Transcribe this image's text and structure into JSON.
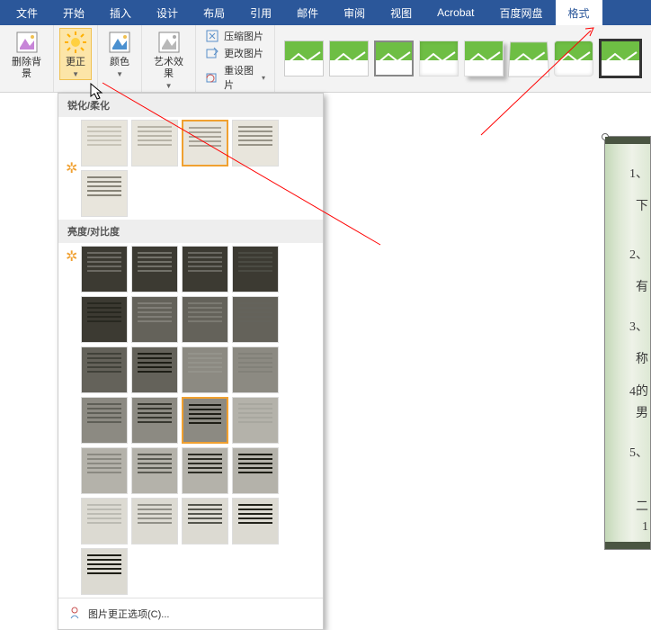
{
  "menubar": {
    "tabs": [
      {
        "label": "文件"
      },
      {
        "label": "开始"
      },
      {
        "label": "插入"
      },
      {
        "label": "设计"
      },
      {
        "label": "布局"
      },
      {
        "label": "引用"
      },
      {
        "label": "邮件"
      },
      {
        "label": "审阅"
      },
      {
        "label": "视图"
      },
      {
        "label": "Acrobat"
      },
      {
        "label": "百度网盘"
      },
      {
        "label": "格式"
      }
    ],
    "active_index": 11
  },
  "ribbon": {
    "remove_bg": "删除背景",
    "corrections": "更正",
    "color": "颜色",
    "artistic": "艺术效果",
    "compress": "压缩图片",
    "change": "更改图片",
    "reset": "重设图片"
  },
  "dropdown": {
    "section_sharpen": "锐化/柔化",
    "section_brightness": "亮度/对比度",
    "footer": "图片更正选项(C)...",
    "sharpen_count": 5,
    "sharpen_selected": 2,
    "brightness_rows": 5,
    "brightness_cols": 5,
    "brightness_selected": [
      2,
      4
    ]
  },
  "style_gallery": {
    "count": 8,
    "selected_index": 7
  }
}
